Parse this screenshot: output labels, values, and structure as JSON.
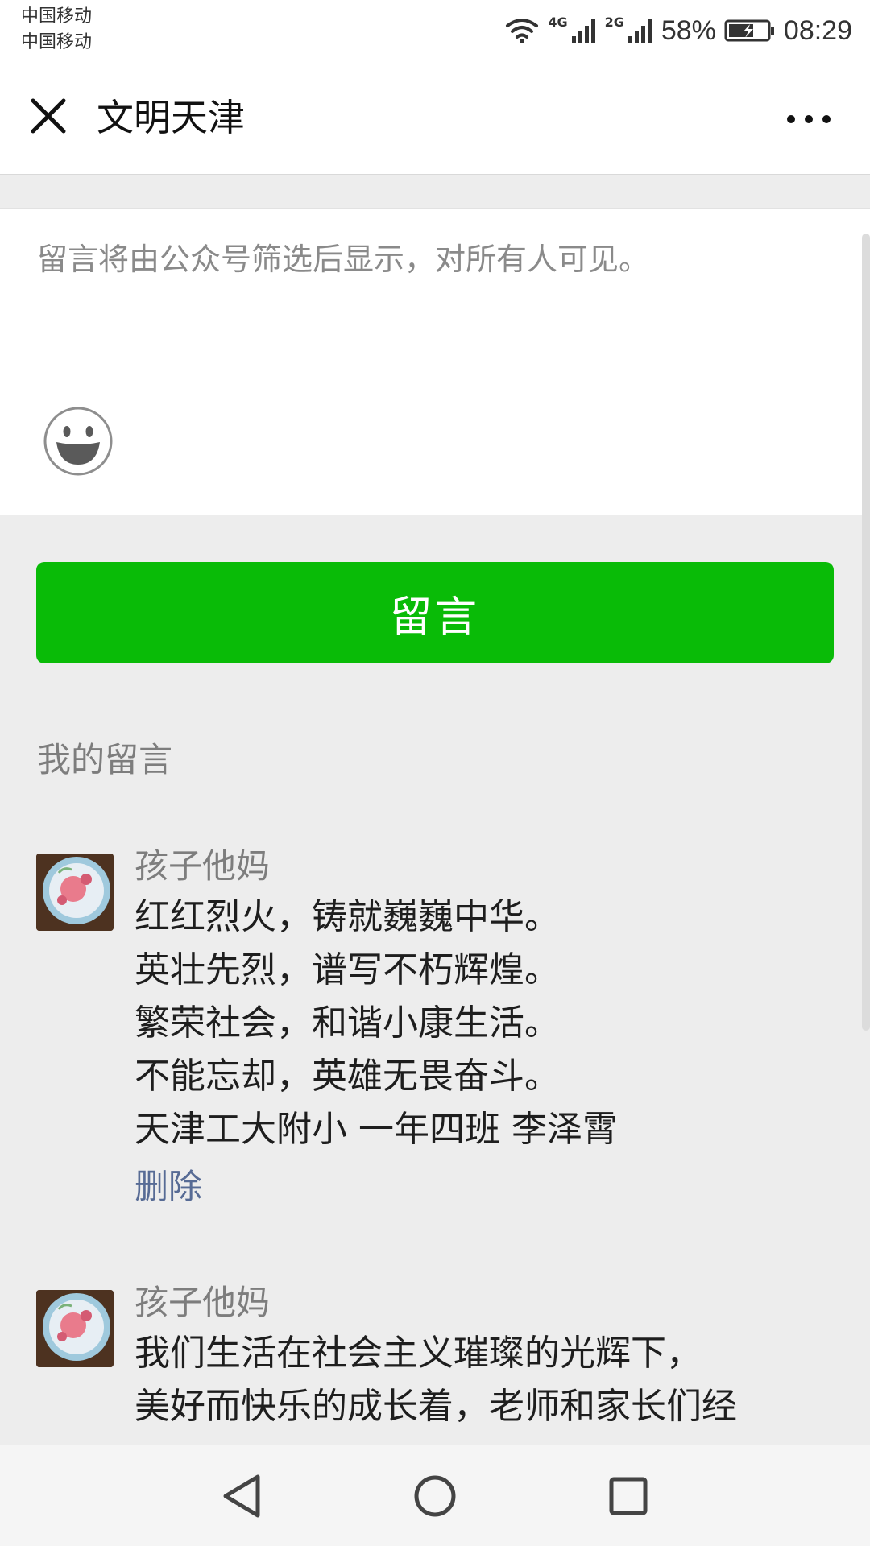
{
  "status_bar": {
    "carrier_1": "中国移动",
    "carrier_2": "中国移动",
    "net_4g": "4G",
    "net_2g": "2G",
    "battery": "58%",
    "time": "08:29",
    "icons": [
      "wifi-icon",
      "signal-icon",
      "battery-icon"
    ]
  },
  "header": {
    "title": "文明天津",
    "close_icon": "close-icon",
    "more_icon": "more-icon"
  },
  "compose": {
    "placeholder": "留言将由公众号筛选后显示，对所有人可见。",
    "value": "",
    "emoji_icon": "emoji-icon"
  },
  "submit": {
    "label": "留言",
    "color": "#09BB07"
  },
  "my_comments": {
    "title": "我的留言",
    "items": [
      {
        "nickname": "孩子他妈",
        "lines": [
          "红红烈火，铸就巍巍中华。",
          "英壮先烈，谱写不朽辉煌。",
          "繁荣社会，和谐小康生活。",
          "不能忘却，英雄无畏奋斗。",
          "天津工大附小  一年四班  李泽霄"
        ],
        "delete_label": "删除"
      },
      {
        "nickname": "孩子他妈",
        "lines": [
          "我们生活在社会主义璀璨的光辉下，",
          "美好而快乐的成长着，老师和家长们经"
        ]
      }
    ]
  },
  "colors": {
    "link": "#576B95",
    "background": "#EDEDED"
  },
  "nav_bar": {
    "icons": [
      "back-icon",
      "home-icon",
      "recent-apps-icon"
    ]
  }
}
